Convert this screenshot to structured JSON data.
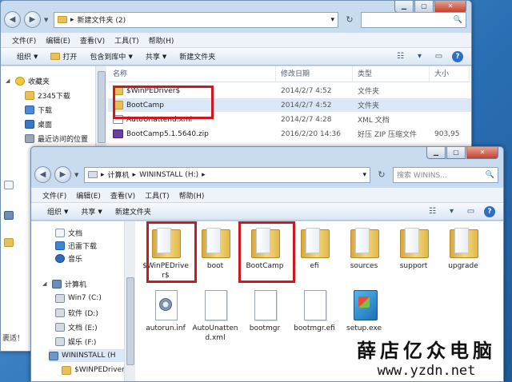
{
  "back_window": {
    "address_path": [
      "新建文件夹 (2)"
    ],
    "menu": [
      "文件(F)",
      "编辑(E)",
      "查看(V)",
      "工具(T)",
      "帮助(H)"
    ],
    "toolbar": {
      "organize": "组织",
      "open": "打开",
      "include_library": "包含到库中",
      "share": "共享",
      "new_folder": "新建文件夹"
    },
    "sidebar": [
      "收藏夹",
      "2345下载",
      "下载",
      "桌面",
      "最近访问的位置"
    ],
    "columns": [
      "名称",
      "修改日期",
      "类型",
      "大小"
    ],
    "files": [
      {
        "name": "$WinPEDriver$",
        "date": "2014/2/7 4:52",
        "type": "文件夹",
        "size": "",
        "icon": "folder"
      },
      {
        "name": "BootCamp",
        "date": "2014/2/7 4:52",
        "type": "文件夹",
        "size": "",
        "icon": "folder"
      },
      {
        "name": "AutoUnattend.xml",
        "date": "2014/2/7 4:28",
        "type": "XML 文档",
        "size": "",
        "icon": "xml"
      },
      {
        "name": "BootCamp5.1.5640.zip",
        "date": "2016/2/20 14:36",
        "type": "好压 ZIP 压缩文件",
        "size": "903,95",
        "icon": "zip"
      }
    ],
    "status_text": "裹适！"
  },
  "front_window": {
    "address_path": [
      "计算机",
      "WININSTALL (H:)"
    ],
    "search_placeholder": "搜索 WININS...",
    "menu": [
      "文件(F)",
      "编辑(E)",
      "查看(V)",
      "工具(T)",
      "帮助(H)"
    ],
    "toolbar": {
      "organize": "组织",
      "share": "共享",
      "new_folder": "新建文件夹"
    },
    "sidebar": [
      {
        "label": "文档",
        "icon": "doc"
      },
      {
        "label": "迅雷下载",
        "icon": "thunder"
      },
      {
        "label": "音乐",
        "icon": "music"
      },
      {
        "label": "计算机",
        "icon": "pc"
      },
      {
        "label": "Win7 (C:)",
        "icon": "drive"
      },
      {
        "label": "软件 (D:)",
        "icon": "drive"
      },
      {
        "label": "文档 (E:)",
        "icon": "drive"
      },
      {
        "label": "娱乐 (F:)",
        "icon": "drive"
      },
      {
        "label": "WININSTALL (H",
        "icon": "usb"
      },
      {
        "label": "$WINPEDriver",
        "icon": "folder"
      }
    ],
    "items": [
      {
        "label": "$WinPEDriver$",
        "icon": "folder"
      },
      {
        "label": "boot",
        "icon": "folder"
      },
      {
        "label": "BootCamp",
        "icon": "folder"
      },
      {
        "label": "efi",
        "icon": "folder"
      },
      {
        "label": "sources",
        "icon": "folder"
      },
      {
        "label": "support",
        "icon": "folder"
      },
      {
        "label": "upgrade",
        "icon": "folder"
      },
      {
        "label": "autorun.inf",
        "icon": "gear"
      },
      {
        "label": "AutoUnattend.xml",
        "icon": "file"
      },
      {
        "label": "bootmgr",
        "icon": "file"
      },
      {
        "label": "bootmgr.efi",
        "icon": "file"
      },
      {
        "label": "setup.exe",
        "icon": "setup"
      }
    ]
  },
  "watermark": {
    "cn": "薛店亿众电脑",
    "url": "www.yzdn.net"
  },
  "colors": {
    "highlight": "#d0171d",
    "selection": "#dbe8f7"
  }
}
